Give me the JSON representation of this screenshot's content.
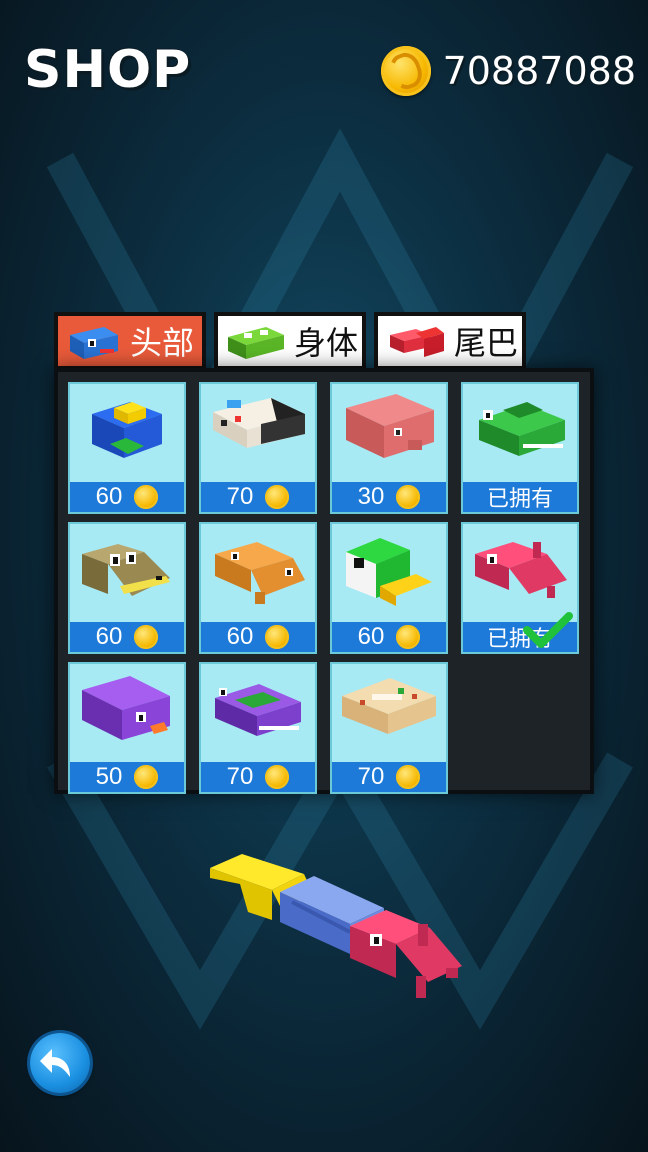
{
  "header": {
    "title": "SHOP",
    "coin_count": "70887088"
  },
  "tabs": [
    {
      "label": "头部",
      "icon": "head-tab-icon",
      "active": true
    },
    {
      "label": "身体",
      "icon": "body-tab-icon",
      "active": false
    },
    {
      "label": "尾巴",
      "icon": "tail-tab-icon",
      "active": false
    }
  ],
  "items": [
    {
      "name": "blue-flower-head",
      "price": "60",
      "owned": ""
    },
    {
      "name": "panda-head",
      "price": "70",
      "owned": ""
    },
    {
      "name": "pink-pig-head",
      "price": "30",
      "owned": ""
    },
    {
      "name": "green-frog-head",
      "price": "",
      "owned": "已拥有"
    },
    {
      "name": "crocodile-head",
      "price": "60",
      "owned": ""
    },
    {
      "name": "orange-hippo-head",
      "price": "60",
      "owned": ""
    },
    {
      "name": "green-duck-head",
      "price": "60",
      "owned": ""
    },
    {
      "name": "pink-dragon-head",
      "price": "",
      "owned": "已拥有",
      "selected": true
    },
    {
      "name": "purple-bird-head",
      "price": "50",
      "owned": ""
    },
    {
      "name": "purple-monster-head",
      "price": "70",
      "owned": ""
    },
    {
      "name": "cookie-head",
      "price": "70",
      "owned": ""
    }
  ],
  "colors": {
    "active_tab": "#e85a3a",
    "price_bar": "#1e7ad8",
    "card_bg": "#a7eaf4",
    "coin": "#f6b800"
  },
  "icons": {
    "coin": "coin-icon",
    "back": "back-arrow-icon",
    "selected": "checkmark-icon"
  }
}
